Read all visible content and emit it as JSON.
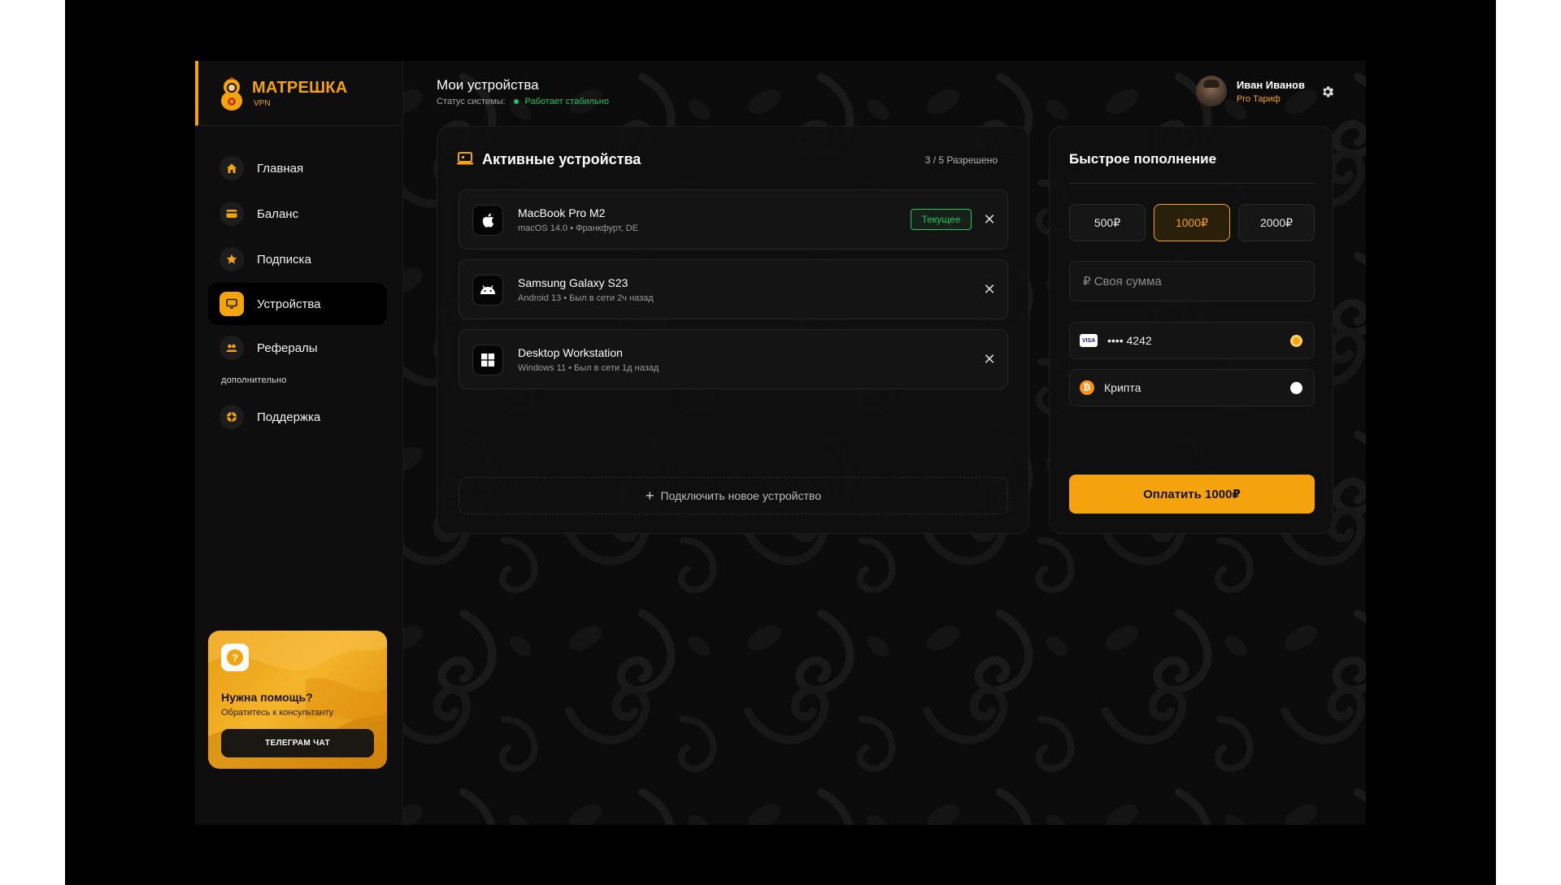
{
  "brand": {
    "name": "МАТРЕШКА",
    "sub": "VPN"
  },
  "sidebar": {
    "items": [
      {
        "label": "Главная",
        "icon": "home-icon"
      },
      {
        "label": "Баланс",
        "icon": "card-icon"
      },
      {
        "label": "Подписка",
        "icon": "star-icon"
      },
      {
        "label": "Устройства",
        "icon": "monitor-icon",
        "active": true
      },
      {
        "label": "Рефералы",
        "icon": "people-icon"
      }
    ],
    "section_label": "дополнительно",
    "extra_items": [
      {
        "label": "Поддержка",
        "icon": "support-icon"
      }
    ]
  },
  "help": {
    "title": "Нужна помощь?",
    "subtitle": "Обратитесь к консультанту",
    "button": "ТЕЛЕГРАМ ЧАТ"
  },
  "header": {
    "title": "Мои устройства",
    "status_label": "Статус системы:",
    "status_value": "Работает стабильно"
  },
  "user": {
    "name": "Иван Иванов",
    "plan": "Pro Тариф"
  },
  "devices": {
    "title": "Активные устройства",
    "count": "3 / 5 Разрешено",
    "items": [
      {
        "name": "MacBook Pro M2",
        "meta": "macOS 14.0 • Франкфурт, DE",
        "icon": "apple-icon",
        "badge": "Текущее"
      },
      {
        "name": "Samsung Galaxy S23",
        "meta": "Android 13 • Был в сети 2ч назад",
        "icon": "android-icon"
      },
      {
        "name": "Desktop Workstation",
        "meta": "Windows 11 • Был в сети 1д назад",
        "icon": "windows-icon"
      }
    ],
    "add_label": "Подключить новое устройство"
  },
  "topup": {
    "title": "Быстрое пополнение",
    "amounts": [
      "500₽",
      "1000₽",
      "2000₽"
    ],
    "selected_amount": "1000₽",
    "custom_placeholder": "₽ Своя сумма",
    "methods": [
      {
        "label": "•••• 4242",
        "icon": "visa-icon",
        "selected": true
      },
      {
        "label": "Крипта",
        "icon": "bitcoin-icon",
        "selected": false
      }
    ],
    "pay_label": "Оплатить 1000₽"
  },
  "colors": {
    "accent": "#f5a30c",
    "success": "#22c55e",
    "background": "#0b0b0b"
  }
}
